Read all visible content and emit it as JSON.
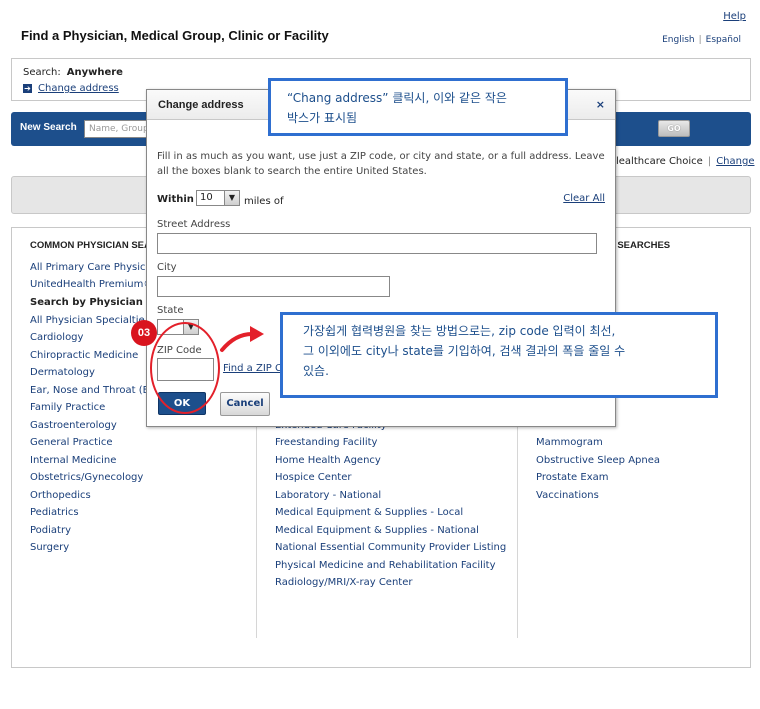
{
  "header": {
    "help": "Help",
    "title": "Find a Physician, Medical Group, Clinic or Facility",
    "lang_en": "English",
    "lang_es": "Español"
  },
  "search": {
    "label": "Search:",
    "location": "Anywhere",
    "change_link": "Change address"
  },
  "new_search": {
    "label": "New Search",
    "placeholder": "Name, Group",
    "go": "GO"
  },
  "plan": {
    "name": "lealthcare Choice",
    "change": "Change"
  },
  "columns": {
    "col1": {
      "heading": "COMMON PHYSICIAN SEA",
      "items": [
        "All Primary Care Physicia",
        "UnitedHealth Premium®"
      ],
      "subheading": "Search by Physician Spe",
      "items2": [
        "All Physician Specialtie",
        "Cardiology",
        "Chiropractic Medicine",
        "Dermatology",
        "Ear, Nose and Throat (EN",
        "Family Practice",
        "Gastroenterology",
        "General Practice",
        "Internal Medicine",
        "Obstetrics/Gynecology",
        "Orthopedics",
        "Pediatrics",
        "Podiatry",
        "Surgery"
      ]
    },
    "col2": {
      "items": [
        "Extended Care Facility",
        "Freestanding Facility",
        "Home Health Agency",
        "Hospice Center",
        "Laboratory - National",
        "Medical Equipment & Supplies - Local",
        "Medical Equipment & Supplies - National",
        "National Essential Community Provider Listing",
        "Physical Medicine and Rehabilitation Facility",
        "Radiology/MRI/X-ray Center"
      ]
    },
    "col3": {
      "heading": "TION SEARCHES",
      "first": "er",
      "items": [
        "Mammogram",
        "Obstructive Sleep Apnea",
        "Prostate Exam",
        "Vaccinations"
      ]
    }
  },
  "dialog": {
    "title": "Change address",
    "close": "×",
    "intro": "Fill in as much as you want, use just a ZIP code, or city and state, or a full address. Leave all the boxes blank to search the entire United States.",
    "within_label": "Within",
    "within_value": "10",
    "miles_label": "miles of",
    "clear_all": "Clear All",
    "street_label": "Street Address",
    "city_label": "City",
    "state_label": "State",
    "zip_label": "ZIP Code",
    "find_zip": "Find a ZIP C",
    "ok": "OK",
    "cancel": "Cancel"
  },
  "annotations": {
    "callout1_line1": "“Chang address” 클릭시, 이와 같은 작은",
    "callout1_line2": "박스가 표시됨",
    "callout2_line1": "가장쉽게 협력병원을 찾는 방법으로는, zip code 입력이 최선,",
    "callout2_line2": "그 이외에도 city나 state를 기입하여, 검색 결과의 폭을 줄일 수",
    "callout2_line3": "있슴.",
    "step_badge": "03",
    "accent_color": "#2f6fd0",
    "marker_color": "#e3202a"
  }
}
